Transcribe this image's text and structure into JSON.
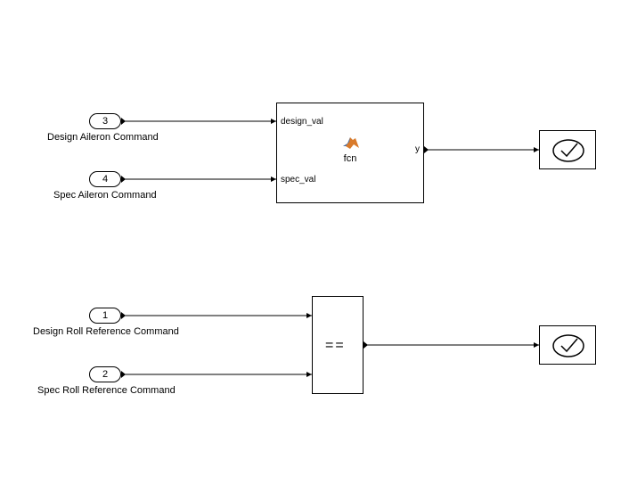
{
  "ports": {
    "p3": {
      "num": "3",
      "label": "Design Aileron Command"
    },
    "p4": {
      "num": "4",
      "label": "Spec Aileron Command"
    },
    "p1": {
      "num": "1",
      "label": "Design Roll Reference Command"
    },
    "p2": {
      "num": "2",
      "label": "Spec Roll Reference Command"
    }
  },
  "fcn_block": {
    "in1": "design_val",
    "in2": "spec_val",
    "out": "y",
    "name": "fcn"
  },
  "compare_block": {
    "op": "=="
  }
}
